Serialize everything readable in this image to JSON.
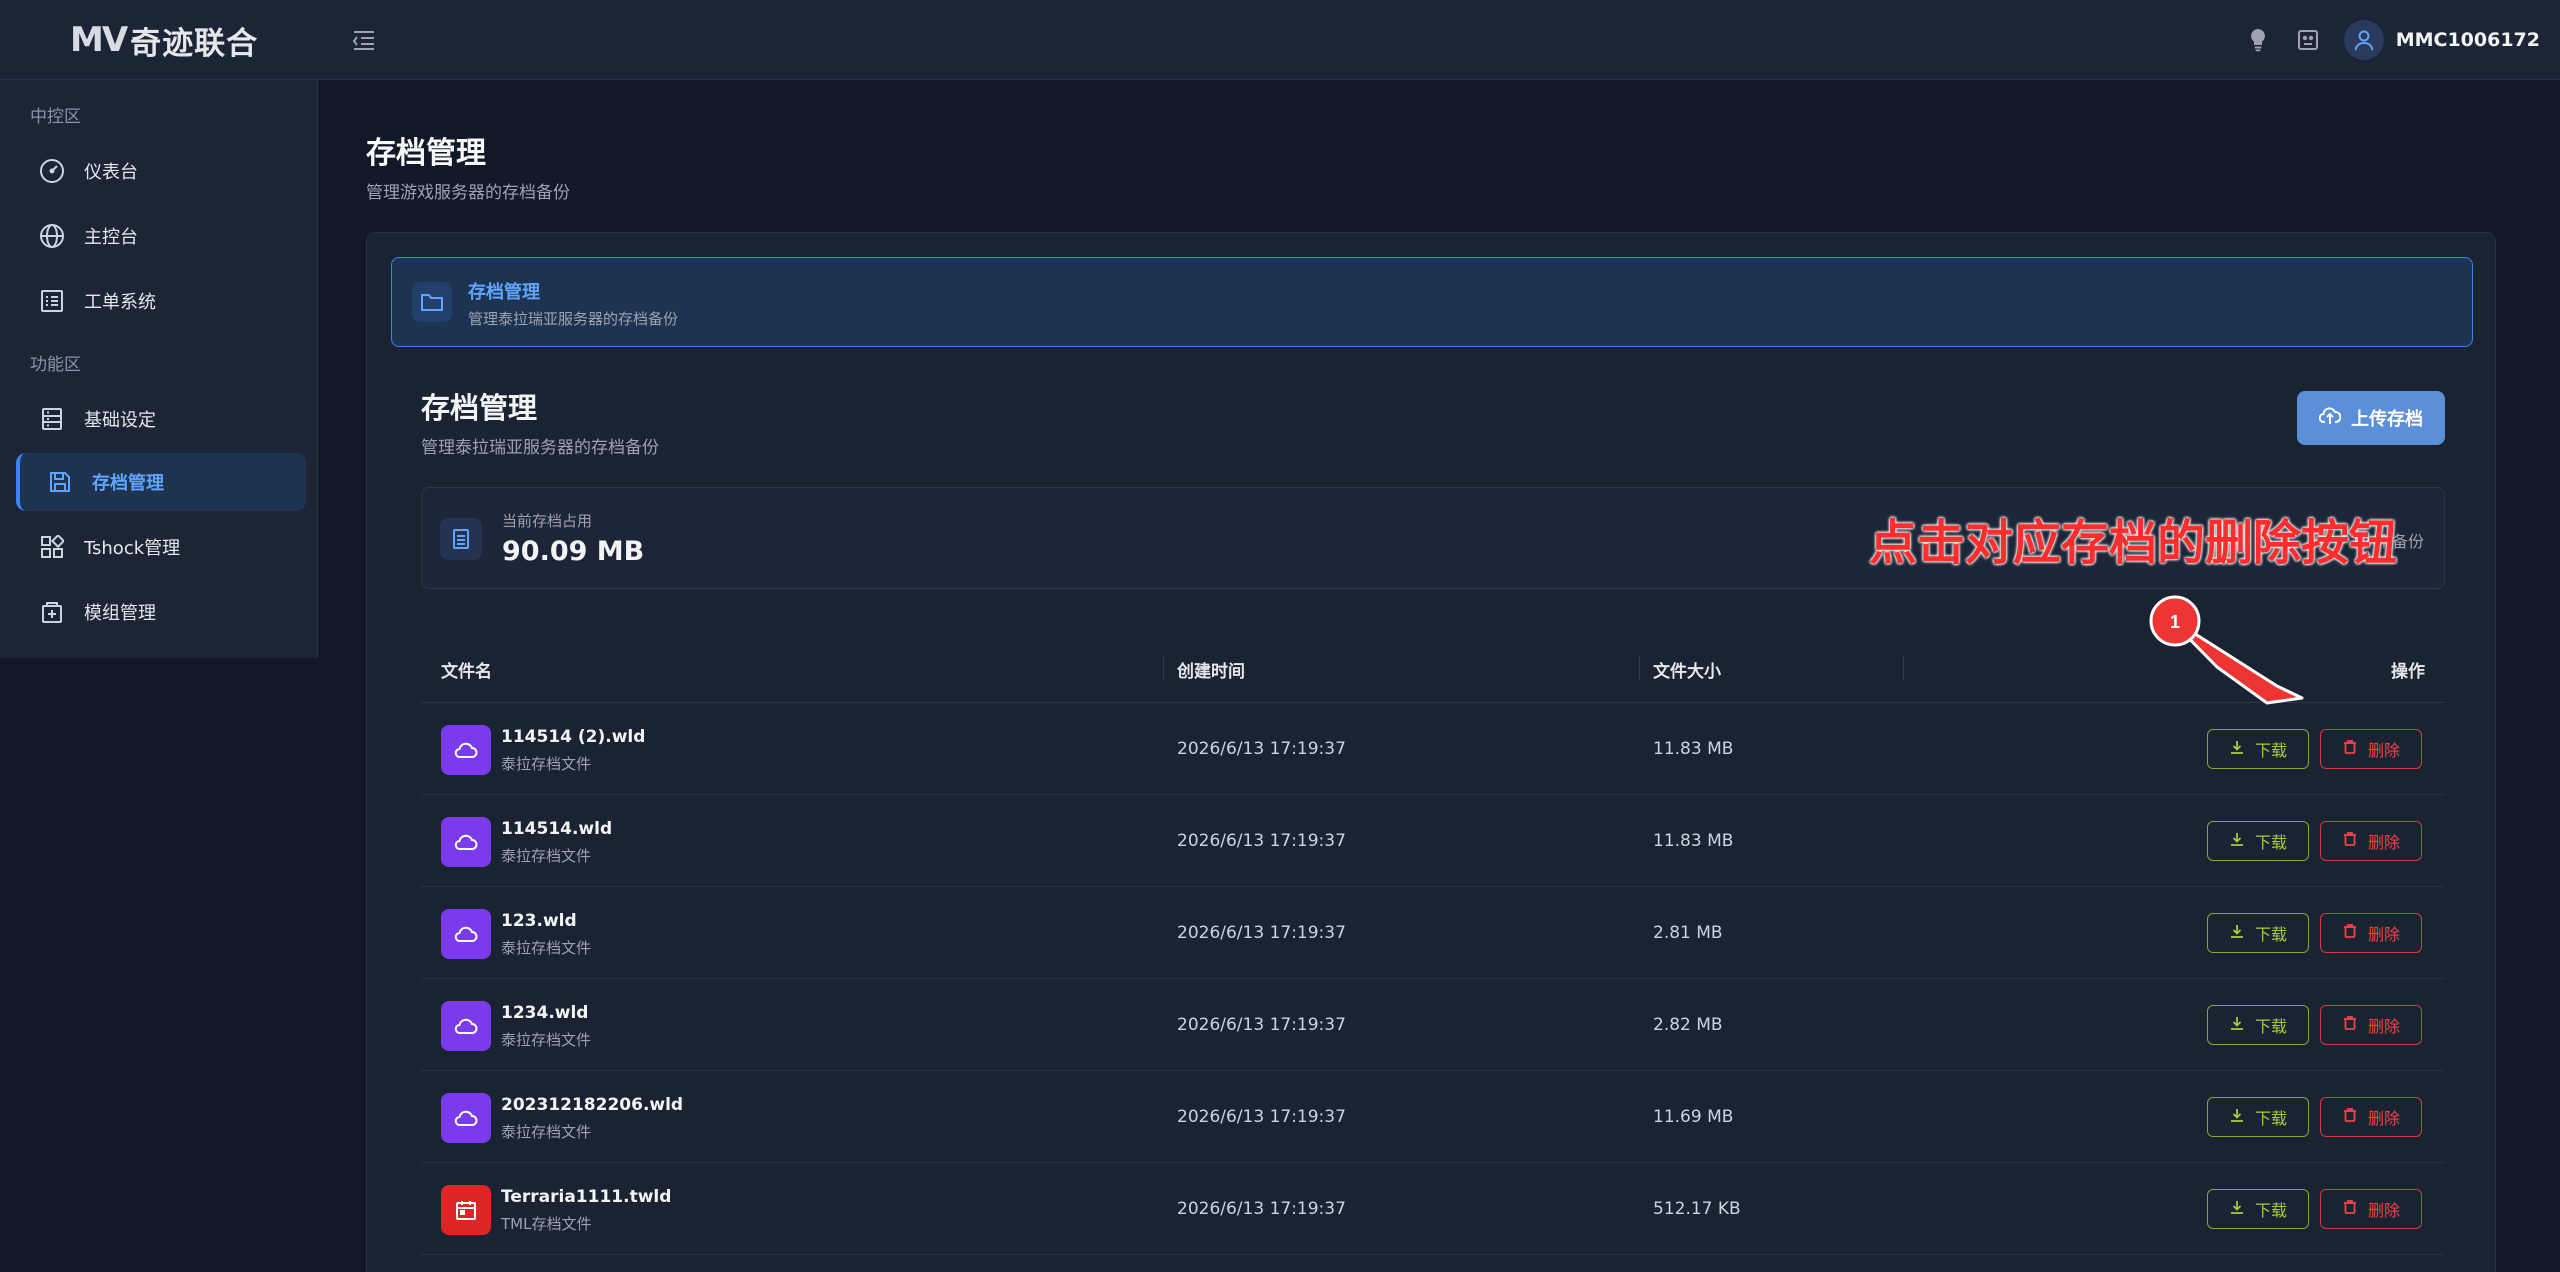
{
  "app": {
    "logo_mark": "MV",
    "logo_text": "奇迹联合",
    "username": "MMC1006172"
  },
  "sidebar": {
    "section1": "中控区",
    "section2": "功能区",
    "items": [
      {
        "label": "仪表台",
        "icon": "gauge-icon"
      },
      {
        "label": "主控台",
        "icon": "globe-icon"
      },
      {
        "label": "工单系统",
        "icon": "list-icon"
      },
      {
        "label": "基础设定",
        "icon": "server-icon"
      },
      {
        "label": "存档管理",
        "icon": "save-icon",
        "active": true
      },
      {
        "label": "Tshock管理",
        "icon": "grid-icon"
      },
      {
        "label": "模组管理",
        "icon": "package-icon"
      }
    ]
  },
  "page": {
    "title": "存档管理",
    "subtitle": "管理游戏服务器的存档备份"
  },
  "banner": {
    "title": "存档管理",
    "subtitle": "管理泰拉瑞亚服务器的存档备份"
  },
  "section": {
    "title": "存档管理",
    "subtitle": "管理泰拉瑞亚服务器的存档备份",
    "upload_label": "上传存档"
  },
  "usage": {
    "label": "当前存档占用",
    "value": "90.09 MB",
    "count": "12 个备份"
  },
  "annotation": {
    "text": "点击对应存档的删除按钮",
    "step": "1"
  },
  "table": {
    "headers": [
      "文件名",
      "创建时间",
      "文件大小",
      "操作"
    ],
    "download_label": "下载",
    "delete_label": "删除",
    "rows": [
      {
        "name": "114514 (2).wld",
        "type": "泰拉存档文件",
        "time": "2026/6/13 17:19:37",
        "size": "11.83 MB",
        "kind": "wld"
      },
      {
        "name": "114514.wld",
        "type": "泰拉存档文件",
        "time": "2026/6/13 17:19:37",
        "size": "11.83 MB",
        "kind": "wld"
      },
      {
        "name": "123.wld",
        "type": "泰拉存档文件",
        "time": "2026/6/13 17:19:37",
        "size": "2.81 MB",
        "kind": "wld"
      },
      {
        "name": "1234.wld",
        "type": "泰拉存档文件",
        "time": "2026/6/13 17:19:37",
        "size": "2.82 MB",
        "kind": "wld"
      },
      {
        "name": "202312182206.wld",
        "type": "泰拉存档文件",
        "time": "2026/6/13 17:19:37",
        "size": "11.69 MB",
        "kind": "wld"
      },
      {
        "name": "Terraria1111.twld",
        "type": "TML存档文件",
        "time": "2026/6/13 17:19:37",
        "size": "512.17 KB",
        "kind": "twld"
      }
    ]
  },
  "colors": {
    "accent": "#3b82f6",
    "download": "#a3cc3f",
    "delete": "#ef4444",
    "annotation": "#ff2d2d"
  }
}
